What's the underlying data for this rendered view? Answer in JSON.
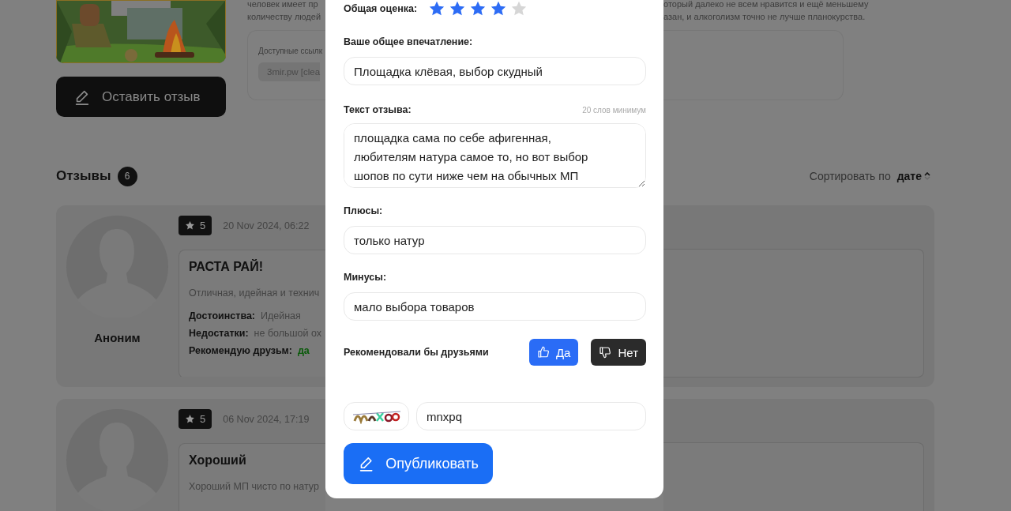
{
  "background": {
    "product": {
      "kind": "picture",
      "button": "Оставить отзыв",
      "description_lines_left": [
        "человек имеет пр",
        "количеству людей"
      ],
      "description_lines_right": [
        "оторый далеко не всем нравится и ещё меньшему",
        "азан, и алкоголизм точно не лучше планокурства."
      ],
      "links_label": "Доступные ссылк",
      "link": "3mir.pw [clea"
    },
    "reviews_heading": {
      "title": "Отзывы",
      "count": "6",
      "sort_label": "Сортировать по",
      "sort_value": "дате"
    },
    "reviews": [
      {
        "author": "Аноним",
        "rating": "5",
        "date": "20 Nov 2024, 06:22",
        "title": "РАСТА РАЙ!",
        "text": "Отличная, идейная и технич",
        "pros_label": "Достоинства:",
        "pros": "Идейная",
        "cons_label": "Недостатки:",
        "cons": "не большой ох",
        "recommend_label": "Рекомендую друзьм:",
        "recommend": "да"
      },
      {
        "rating": "5",
        "date": "06 Nov 2024, 17:19",
        "title": "Хороший",
        "text": "Хороший МП чисто по натур"
      }
    ]
  },
  "review_form": {
    "rating": {
      "label": "Общая оценка:",
      "stars": 4
    },
    "impression": {
      "label": "Ваше общее впечатление:",
      "value": "Площадка клёвая, выбор скудный"
    },
    "review_text": {
      "label": "Текст отзыва:",
      "hint": "20 слов минимум",
      "value": "площадка сама по себе афигенная, любителям натура самое то, но вот выбор шопов по сути ниже чем на обычных МП"
    },
    "pros": {
      "label": "Плюсы:",
      "value": "только натур"
    },
    "cons": {
      "label": "Минусы:",
      "value": "мало выбора товаров"
    },
    "recommend": {
      "label": "Рекомендовали бы друзьями",
      "options": [
        {
          "label": "Да",
          "kind": "up",
          "selected": true
        },
        {
          "label": "Нет",
          "kind": "down",
          "selected": false
        }
      ]
    },
    "captcha": {
      "kind": "picture",
      "value": "mnxpq"
    },
    "submit": "Опубликовать"
  }
}
